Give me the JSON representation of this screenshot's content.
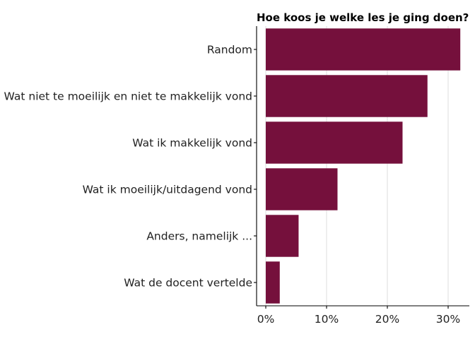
{
  "chart_data": {
    "type": "bar",
    "orientation": "horizontal",
    "title": "Hoe koos je welke les je ging doen?",
    "xlabel": "",
    "ylabel": "",
    "categories": [
      "Random",
      "Wat niet te moeilijk en niet te makkelijk vond",
      "Wat ik makkelijk vond",
      "Wat ik moeilijk/uitdagend vond",
      "Anders, namelijk ...",
      "Wat de docent vertelde"
    ],
    "values": [
      32.0,
      26.6,
      22.5,
      11.8,
      5.4,
      2.3
    ],
    "value_format": "percent",
    "xlim": [
      0,
      33
    ],
    "x_ticks": [
      0,
      10,
      20,
      30
    ],
    "x_tick_labels": [
      "0%",
      "10%",
      "20%",
      "30%"
    ],
    "grid": "vertical major lines",
    "legend": "none",
    "bar_color": "#75103c"
  }
}
